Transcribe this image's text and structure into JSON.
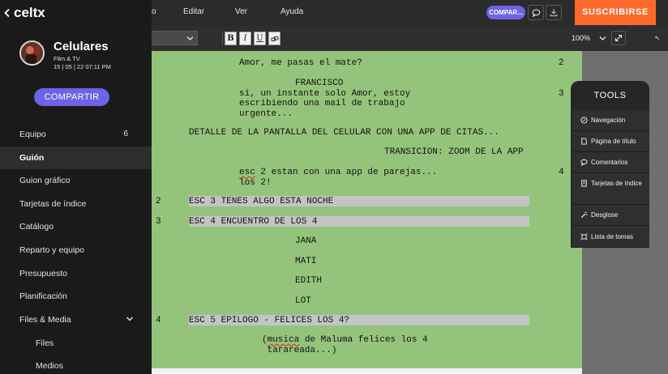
{
  "menu": {
    "partial": "o",
    "items": [
      "Editar",
      "Ver",
      "Ayuda"
    ]
  },
  "header": {
    "compartir_pill": "COMPAR...",
    "subscribe": "SUSCRIBIRSE"
  },
  "toolbar": {
    "bold": "B",
    "italic": "I",
    "underline": "U",
    "zoom": "100%"
  },
  "app": {
    "name": "celtx"
  },
  "project": {
    "title": "Celulares",
    "type": "Film & TV",
    "date": "15 | 05 | 22 07:11 PM"
  },
  "sidebar": {
    "share": "COMPARTIR",
    "items": [
      {
        "label": "Equipo",
        "count": "6"
      },
      {
        "label": "Guión"
      },
      {
        "label": "Guion gráfico"
      },
      {
        "label": "Tarjetas de índice"
      },
      {
        "label": "Catálogo"
      },
      {
        "label": "Reparto y equipo"
      },
      {
        "label": "Presupuesto"
      },
      {
        "label": "Planificación"
      },
      {
        "label": "Files & Media"
      },
      {
        "label": "Files"
      },
      {
        "label": "Medios"
      }
    ]
  },
  "tools": {
    "title": "TOOLS",
    "items": [
      "Navegación",
      "Página de título",
      "Comentarios",
      "Tarjetas de índice",
      "Desglose",
      "Lista de tomas"
    ]
  },
  "script": {
    "l1": "Amor, me pasas el mate?",
    "n1": "2",
    "c1": "FRANCISCO",
    "d1a": "si, un instante solo Amor, estoy",
    "d1b": "escribiendo una mail de trabajo",
    "d1c": "urgente...",
    "n2": "3",
    "a1": "DETALLE DE LA PANTALLA DEL CELULAR CON UNA APP DE CITAS...",
    "t1": "TRANSICION: ZOOM DE LA APP",
    "d2a_word": "esc",
    "d2a_rest": " 2 estan con una app de parejas...",
    "d2b": "los 2!",
    "n3": "4",
    "s3num": "2",
    "s3": "ESC 3 TENES ALGO ESTA NOCHE",
    "s4num": "3",
    "s4": "ESC 4 ENCUENTRO DE LOS 4",
    "c2": "JANA",
    "c3": "MATI",
    "c4": "EDITH",
    "c5": "LOT",
    "s5num": "4",
    "s5": "ESC 5 EPILOGO - FELICES LOS 4?",
    "p1_open": "(",
    "p1_word": "musica",
    "p1_rest": " de Maluma felices los 4",
    "p1b": " tarareada...)"
  }
}
